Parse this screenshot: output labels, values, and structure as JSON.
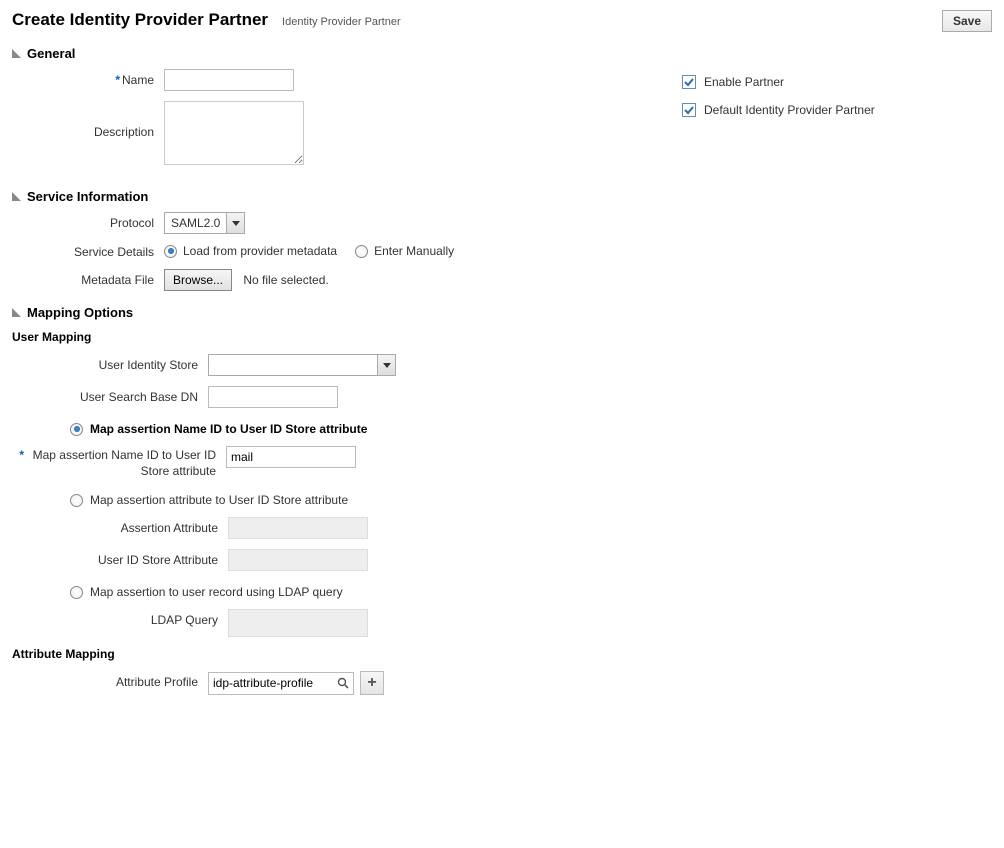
{
  "header": {
    "title": "Create Identity Provider Partner",
    "breadcrumb": "Identity Provider Partner",
    "saveLabel": "Save"
  },
  "general": {
    "title": "General",
    "nameLabel": "Name",
    "nameValue": "",
    "descriptionLabel": "Description",
    "descriptionValue": "",
    "enablePartnerLabel": "Enable Partner",
    "defaultIdpLabel": "Default Identity Provider Partner"
  },
  "serviceInfo": {
    "title": "Service Information",
    "protocolLabel": "Protocol",
    "protocolValue": "SAML2.0",
    "serviceDetailsLabel": "Service Details",
    "loadFromMetadataLabel": "Load from provider metadata",
    "enterManuallyLabel": "Enter Manually",
    "metadataFileLabel": "Metadata File",
    "browseLabel": "Browse...",
    "noFileSelected": "No file selected."
  },
  "mappingOptions": {
    "title": "Mapping Options",
    "userMappingHeading": "User Mapping",
    "userIdentityStoreLabel": "User Identity Store",
    "userIdentityStoreValue": "",
    "userSearchBaseDnLabel": "User Search Base DN",
    "userSearchBaseDnValue": "",
    "mapNameIdRadioLabel": "Map assertion Name ID to User ID Store attribute",
    "mapNameIdFieldLabel": "Map assertion Name ID to User ID Store attribute",
    "mapNameIdFieldValue": "mail",
    "mapAttrRadioLabel": "Map assertion attribute to User ID Store attribute",
    "assertionAttributeLabel": "Assertion Attribute",
    "userIdStoreAttributeLabel": "User ID Store Attribute",
    "mapLdapRadioLabel": "Map assertion to user record using LDAP query",
    "ldapQueryLabel": "LDAP Query",
    "attributeMappingHeading": "Attribute Mapping",
    "attributeProfileLabel": "Attribute Profile",
    "attributeProfileValue": "idp-attribute-profile"
  }
}
